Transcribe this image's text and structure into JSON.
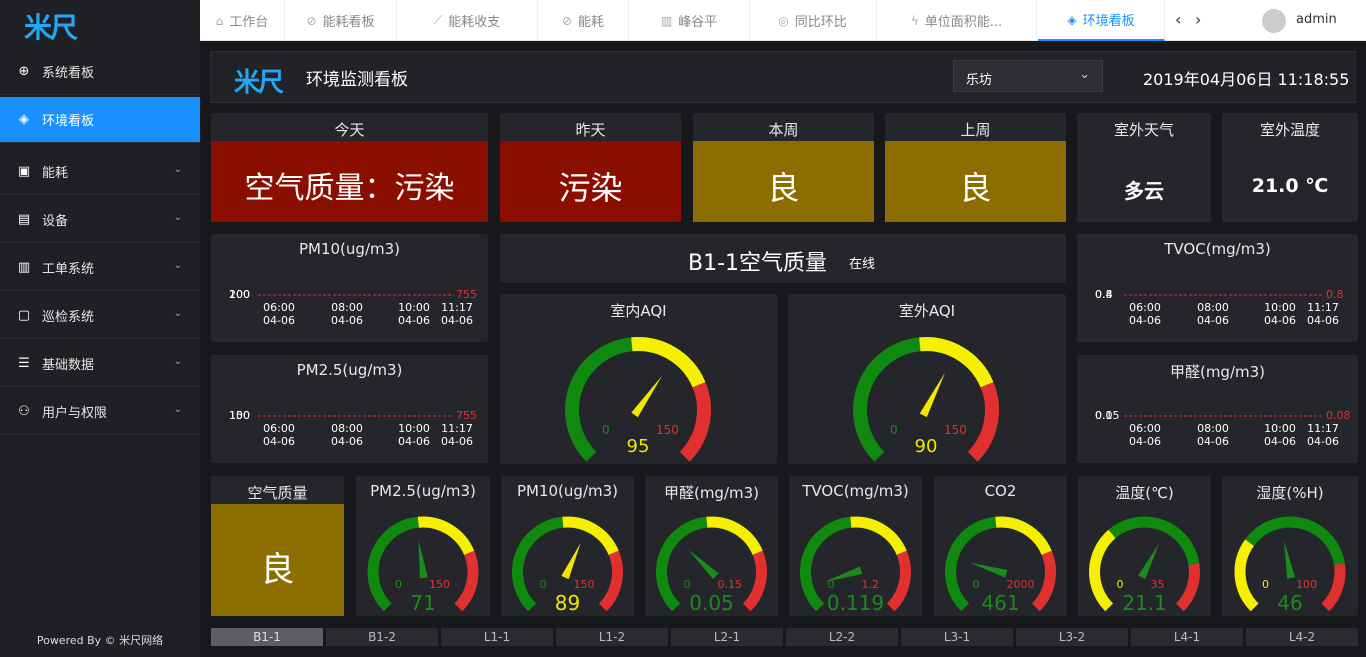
{
  "sidebar": {
    "logo": "米尺",
    "items": [
      {
        "label": "系统看板",
        "icon": "globe-icon",
        "glyph": "⊕",
        "chev": ""
      },
      {
        "label": "环境看板",
        "icon": "leaf-drop-icon",
        "glyph": "◈",
        "chev": ""
      },
      {
        "label": "能耗",
        "icon": "chart-monitor-icon",
        "glyph": "▣",
        "chev": "⌄"
      },
      {
        "label": "设备",
        "icon": "device-icon",
        "glyph": "▤",
        "chev": "⌄"
      },
      {
        "label": "工单系统",
        "icon": "clipboard-icon",
        "glyph": "▥",
        "chev": "⌄"
      },
      {
        "label": "巡检系统",
        "icon": "document-icon",
        "glyph": "▢",
        "chev": "⌄"
      },
      {
        "label": "基础数据",
        "icon": "database-icon",
        "glyph": "☰",
        "chev": "⌄"
      },
      {
        "label": "用户与权限",
        "icon": "user-lock-icon",
        "glyph": "⚇",
        "chev": "⌄"
      }
    ],
    "powered": "Powered By © 米尺网络"
  },
  "tabs": [
    {
      "label": "工作台",
      "icon": "home-icon",
      "glyph": "⌂"
    },
    {
      "label": "能耗看板",
      "icon": "bolt-circle-icon",
      "glyph": "⊘"
    },
    {
      "label": "能耗收支",
      "icon": "line-chart-icon",
      "glyph": "⟋"
    },
    {
      "label": "能耗",
      "icon": "bolt-circle-icon",
      "glyph": "⊘"
    },
    {
      "label": "峰谷平",
      "icon": "bar-chart-icon",
      "glyph": "▥"
    },
    {
      "label": "同比环比",
      "icon": "compare-icon",
      "glyph": "◎"
    },
    {
      "label": "单位面积能...",
      "icon": "flash-icon",
      "glyph": "ϟ"
    },
    {
      "label": "环境看板",
      "icon": "drop-icon",
      "glyph": "◈"
    }
  ],
  "user": {
    "name": "admin"
  },
  "header": {
    "logo": "米尺",
    "title": "环境监测看板",
    "location": "乐坊",
    "datetime": "2019年04月06日 11:18:55"
  },
  "summary": [
    {
      "title": "今天",
      "value": "空气质量：污染",
      "color": "#8b0f00"
    },
    {
      "title": "昨天",
      "value": "污染",
      "color": "#8b0f00"
    },
    {
      "title": "本周",
      "value": "良",
      "color": "#8c6d00"
    },
    {
      "title": "上周",
      "value": "良",
      "color": "#8c6d00"
    }
  ],
  "weather": {
    "title": "室外天气",
    "value": "多云"
  },
  "temperature": {
    "title": "室外温度",
    "value": "21.0 ℃"
  },
  "trends": [
    {
      "title": "PM10(ug/m3)",
      "ylabels": [
        "200",
        "100"
      ],
      "last": "755"
    },
    {
      "title": "PM2.5(ug/m3)",
      "ylabels": [
        "150",
        "100"
      ],
      "last": "755"
    },
    {
      "title": "TVOC(mg/m3)",
      "ylabels": [
        "0.8",
        "0.4"
      ],
      "last": "0.8"
    },
    {
      "title": "甲醛(mg/m3)",
      "ylabels": [
        "0.05",
        "0.1"
      ],
      "last": "0.08"
    }
  ],
  "trend_x": [
    {
      "time": "06:00",
      "date": "04-06"
    },
    {
      "time": "08:00",
      "date": "04-06"
    },
    {
      "time": "10:00",
      "date": "04-06"
    },
    {
      "time": "11:17",
      "date": "04-06"
    }
  ],
  "center": {
    "title": "B1-1空气质量",
    "status": "在线"
  },
  "big_gauges": [
    {
      "title": "室内AQI",
      "min": "0",
      "max": "150",
      "value": "95",
      "val_color": "#f3e700"
    },
    {
      "title": "室外AQI",
      "min": "0",
      "max": "150",
      "value": "90",
      "val_color": "#f3e700"
    }
  ],
  "quality": {
    "title": "空气质量",
    "value": "良",
    "color": "#8c6d00"
  },
  "small_gauges": [
    {
      "title": "PM2.5(ug/m3)",
      "min": "0",
      "max": "150",
      "value": "71",
      "val_color": "#1a8c1a",
      "min_color": "#1a8c1a",
      "max_color": "#e03030",
      "scheme": "standard",
      "frac": 0.47
    },
    {
      "title": "PM10(ug/m3)",
      "min": "0",
      "max": "150",
      "value": "89",
      "val_color": "#f3e700",
      "min_color": "#1a8c1a",
      "max_color": "#e03030",
      "scheme": "standard",
      "frac": 0.59
    },
    {
      "title": "甲醛(mg/m3)",
      "min": "0",
      "max": "0.15",
      "value": "0.05",
      "val_color": "#1a8c1a",
      "min_color": "#1a8c1a",
      "max_color": "#e03030",
      "scheme": "standard",
      "frac": 0.33
    },
    {
      "title": "TVOC(mg/m3)",
      "min": "0",
      "max": "1.2",
      "value": "0.119",
      "val_color": "#1a8c1a",
      "min_color": "#1a8c1a",
      "max_color": "#e03030",
      "scheme": "standard",
      "frac": 0.1
    },
    {
      "title": "CO2",
      "min": "0",
      "max": "2000",
      "value": "461",
      "val_color": "#1a8c1a",
      "min_color": "#1a8c1a",
      "max_color": "#e03030",
      "scheme": "standard",
      "frac": 0.23
    },
    {
      "title": "温度(℃)",
      "min": "0",
      "max": "35",
      "value": "21.1",
      "val_color": "#1a8c1a",
      "min_color": "#f3e700",
      "max_color": "#e03030",
      "scheme": "temp",
      "frac": 0.6
    },
    {
      "title": "湿度(%H)",
      "min": "0",
      "max": "100",
      "value": "46",
      "val_color": "#1a8c1a",
      "min_color": "#f3e700",
      "max_color": "#e03030",
      "scheme": "humid",
      "frac": 0.46
    }
  ],
  "big_needle": [
    0.63,
    0.6
  ],
  "floors": [
    "B1-1",
    "B1-2",
    "L1-1",
    "L1-2",
    "L2-1",
    "L2-2",
    "L3-1",
    "L3-2",
    "L4-1",
    "L4-2"
  ],
  "colors": {
    "green": "#0f8a0f",
    "yellow": "#f5f000",
    "red": "#e03030",
    "accent": "#1890ff"
  }
}
